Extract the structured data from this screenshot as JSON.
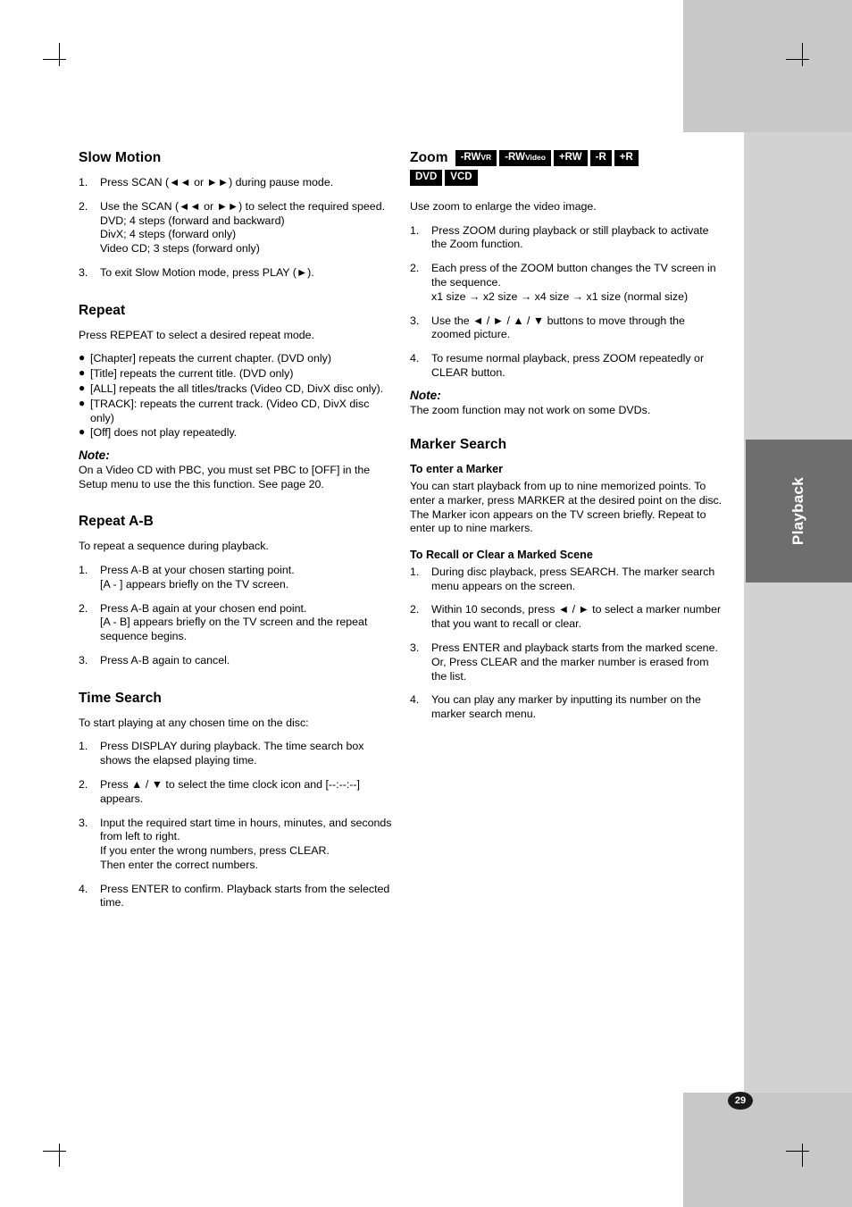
{
  "page": {
    "number": "29",
    "tab_label": "Playback"
  },
  "left_column": {
    "slow_motion": {
      "title": "Slow Motion",
      "steps": [
        {
          "num": "1.",
          "text": "Press SCAN (◄◄ or ►►) during pause mode."
        },
        {
          "num": "2.",
          "text": "Use the SCAN (◄◄ or ►►) to select the required speed.\nDVD; 4 steps (forward and backward)\nDivX; 4 steps (forward only)\nVideo CD; 3 steps (forward only)"
        },
        {
          "num": "3.",
          "text": "To exit Slow Motion mode, press PLAY (►)."
        }
      ]
    },
    "repeat": {
      "title": "Repeat",
      "intro": "Press REPEAT to select a desired repeat mode.",
      "bullets": [
        "[Chapter] repeats the current chapter. (DVD only)",
        "[Title] repeats the current title. (DVD only)",
        "[ALL] repeats the all titles/tracks (Video CD, DivX disc only).",
        "[TRACK]: repeats the current track. (Video CD, DivX disc only)",
        "[Off] does not play repeatedly."
      ],
      "note_title": "Note:",
      "note_text": "On a Video CD with PBC, you must set PBC to [OFF] in the Setup menu to use the this function. See page 20."
    },
    "repeat_ab": {
      "title": "Repeat A-B",
      "intro": "To repeat a sequence during playback.",
      "steps": [
        {
          "num": "1.",
          "text": "Press A-B at your chosen starting point.\n[A - ] appears briefly on the TV screen."
        },
        {
          "num": "2.",
          "text": "Press A-B again at your chosen end point.\n[A - B] appears briefly on the TV screen and the repeat sequence begins."
        },
        {
          "num": "3.",
          "text": "Press A-B again to cancel."
        }
      ]
    },
    "time_search": {
      "title": "Time Search",
      "intro": "To start playing at any chosen time on the disc:",
      "steps": [
        {
          "num": "1.",
          "text": "Press DISPLAY during playback. The time search box shows the elapsed playing time."
        },
        {
          "num": "2.",
          "text": "Press ▲ / ▼ to select the time clock icon and [--:--:--] appears."
        },
        {
          "num": "3.",
          "text": "Input the required start time in hours, minutes, and seconds from left to right.\nIf you enter the wrong numbers, press CLEAR.\nThen enter the correct numbers."
        },
        {
          "num": "4.",
          "text": "Press ENTER to confirm. Playback starts from the selected time."
        }
      ]
    }
  },
  "right_column": {
    "zoom": {
      "title": "Zoom",
      "badges_row1": [
        {
          "main": "-RW",
          "sub": "VR"
        },
        {
          "main": "-RW",
          "sub": "Video"
        },
        {
          "main": "+RW",
          "sub": ""
        },
        {
          "main": "-R",
          "sub": ""
        },
        {
          "main": "+R",
          "sub": ""
        }
      ],
      "badges_row2": [
        {
          "main": "DVD",
          "sub": ""
        },
        {
          "main": "VCD",
          "sub": ""
        }
      ],
      "intro": "Use zoom to enlarge the video image.",
      "steps": [
        {
          "num": "1.",
          "text": "Press ZOOM during playback or still playback to activate the Zoom function."
        },
        {
          "num": "2.",
          "text": "Each press of the ZOOM button changes the TV screen in the sequence.\nx1 size → x2 size → x4 size → x1 size (normal size)"
        },
        {
          "num": "3.",
          "text": "Use the ◄ / ► / ▲ / ▼ buttons to move through the zoomed picture."
        },
        {
          "num": "4.",
          "text": "To resume normal playback, press ZOOM repeatedly or CLEAR button."
        }
      ],
      "note_title": "Note:",
      "note_text": "The zoom function may not work on some DVDs."
    },
    "marker_search": {
      "title": "Marker Search",
      "enter_head": "To enter a Marker",
      "enter_text": "You can start playback from up to nine memorized points. To enter a marker, press MARKER at the desired point on the disc. The Marker icon appears on the TV screen briefly. Repeat to enter up to nine markers.",
      "recall_head": "To Recall or Clear a Marked Scene",
      "steps": [
        {
          "num": "1.",
          "text": "During disc playback, press SEARCH. The marker search menu appears on the screen."
        },
        {
          "num": "2.",
          "text": "Within 10 seconds, press ◄ / ► to select a marker number that you want to recall or clear."
        },
        {
          "num": "3.",
          "text": "Press ENTER and playback starts from the marked scene. Or, Press CLEAR and the marker number is erased from the list."
        },
        {
          "num": "4.",
          "text": "You can play any marker by inputting its number on the marker search menu."
        }
      ]
    }
  }
}
